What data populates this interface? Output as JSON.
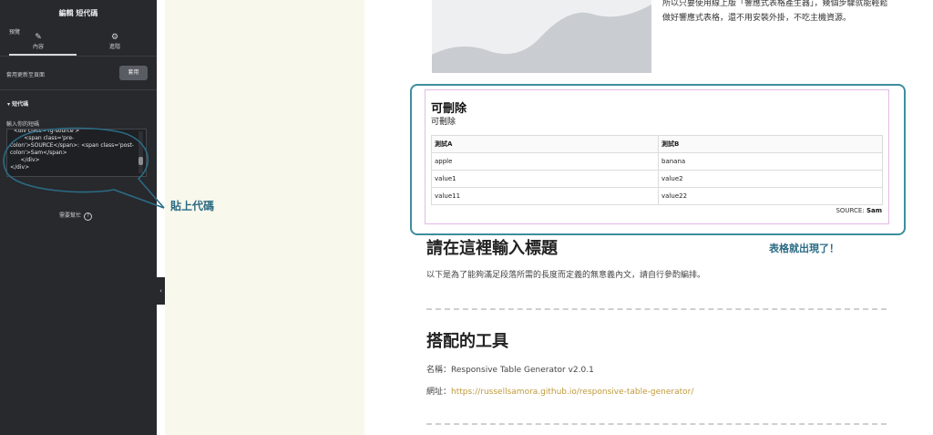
{
  "panel": {
    "title": "編輯 短代碼",
    "preview": "預覽",
    "tabs": [
      {
        "label": "內容",
        "icon": "pencil-icon"
      },
      {
        "label": "進階",
        "icon": "gear-icon"
      }
    ],
    "apply_label": "套用更新至頁面",
    "apply_button": "套用",
    "section": "短代碼",
    "code_label": "輸入你的短碼",
    "code_value": "  <div class='rg-source'>\n        <span class='pre-\ncolon'>SOURCE</span>: <span class='post-\ncolon'>Sam</span>\n      </div>\n</div>",
    "help_text": "需要幫忙",
    "collapse_icon": "chevron-left-icon"
  },
  "annotation": {
    "callout_text": "貼上代碼",
    "callout_color": "#2c6b84"
  },
  "content": {
    "intro_text": "所以只要使用線上版「響應式表格產生器」，幾個步驟就能輕鬆做好響應式表格，還不用安裝外掛，不吃主機資源。",
    "table": {
      "title": "可刪除",
      "subtitle": "可刪除",
      "headers": [
        "測試A",
        "測試B"
      ],
      "rows": [
        [
          "apple",
          "banana"
        ],
        [
          "value1",
          "value2"
        ],
        [
          "value11",
          "value22"
        ]
      ],
      "source_label": "SOURCE:",
      "source_value": "Sam"
    },
    "appear_note": "表格就出現了！",
    "heading1": "請在這裡輸入標題",
    "body_text": "以下是為了能夠滿足段落所需的長度而定義的無意義內文，請自行參酌編排。",
    "heading2": "搭配的工具",
    "name_label": "名稱：Responsive Table Generator v2.0.1",
    "url_label": "網址：",
    "url_value": "https://russellsamora.github.io/responsive-table-generator/"
  },
  "colors": {
    "panel_bg": "#27292d",
    "cream_bg": "#f8f8ec",
    "frame_border": "#3e8e9c",
    "inner_border": "#e5b9e8",
    "link": "#c09a3c"
  }
}
